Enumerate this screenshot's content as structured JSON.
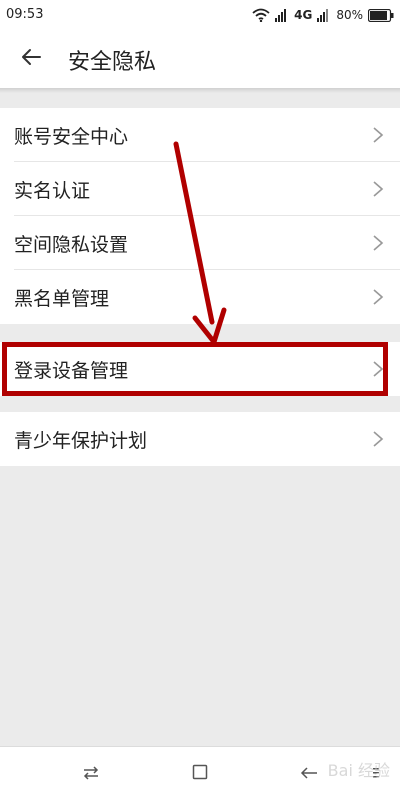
{
  "status_bar": {
    "time": "09:53",
    "network": "4G",
    "battery": "80%"
  },
  "header": {
    "title": "安全隐私",
    "back_icon": "arrow-left-icon"
  },
  "groups": [
    {
      "items": [
        {
          "label": "账号安全中心"
        },
        {
          "label": "实名认证"
        },
        {
          "label": "空间隐私设置"
        },
        {
          "label": "黑名单管理"
        }
      ]
    },
    {
      "items": [
        {
          "label": "登录设备管理"
        }
      ]
    },
    {
      "items": [
        {
          "label": "青少年保护计划"
        }
      ]
    }
  ],
  "annotation": {
    "color": "#b00000"
  },
  "watermark": "Bai 经验"
}
